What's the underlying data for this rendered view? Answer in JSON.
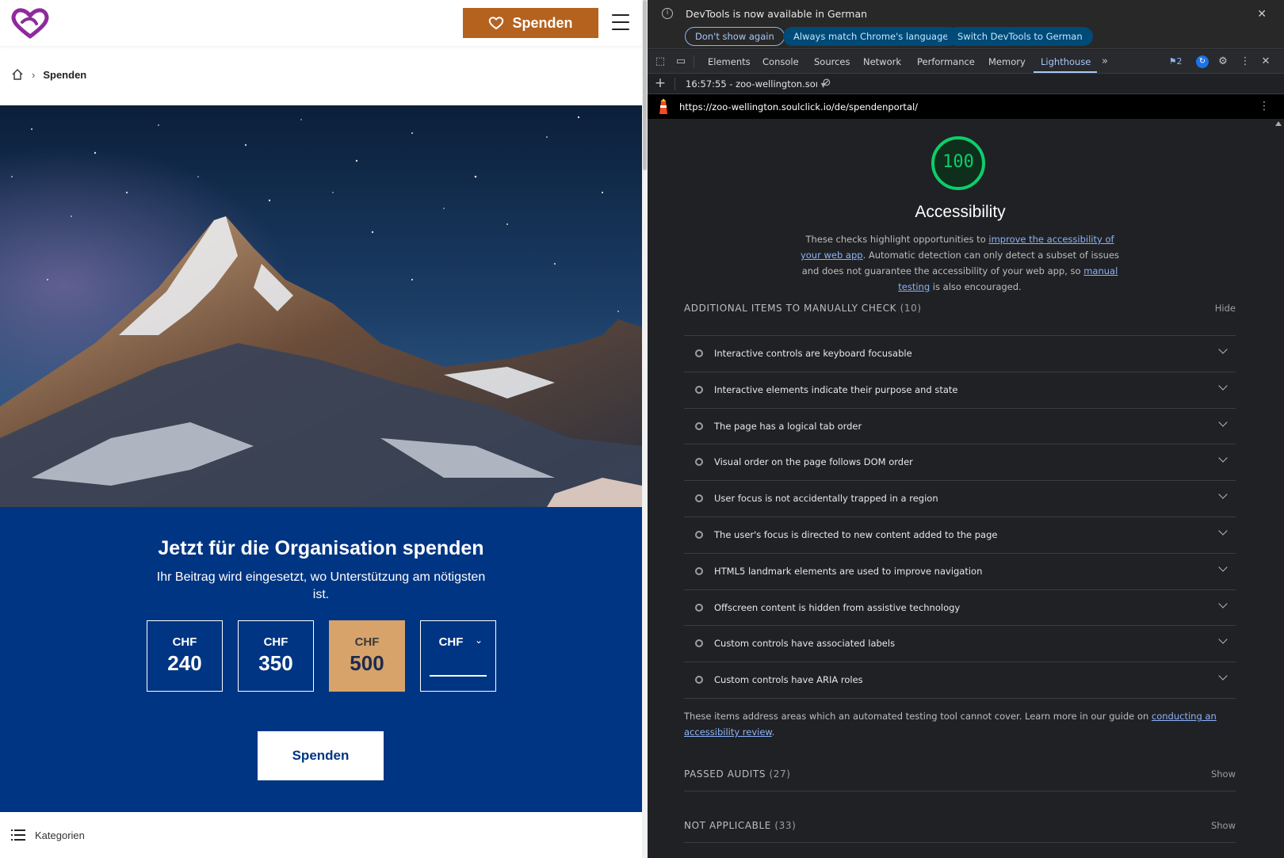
{
  "site": {
    "header": {
      "donate_label": "Spenden"
    },
    "breadcrumb": {
      "current": "Spenden"
    },
    "donation": {
      "title": "Jetzt für die Organisation spenden",
      "subtitle": "Ihr Beitrag wird eingesetzt, wo Unterstützung am nötigsten ist.",
      "currency": "CHF",
      "amounts": [
        {
          "value": "240",
          "selected": false
        },
        {
          "value": "350",
          "selected": false
        },
        {
          "value": "500",
          "selected": true
        }
      ],
      "custom_amount": "",
      "submit_label": "Spenden"
    },
    "footer": {
      "categories_label": "Kategorien"
    },
    "colors": {
      "brand_orange": "#b5621f",
      "panel_blue": "#003583",
      "selected_amount": "#d7a36a",
      "logo_purple": "#8e2a9c"
    }
  },
  "devtools": {
    "infobar": {
      "message": "DevTools is now available in German",
      "buttons": [
        "Don't show again",
        "Always match Chrome's language",
        "Switch DevTools to German"
      ]
    },
    "tabs": [
      "Elements",
      "Console",
      "Sources",
      "Network",
      "Performance",
      "Memory",
      "Lighthouse"
    ],
    "active_tab": "Lighthouse",
    "issues_count": "2",
    "report_selector": "16:57:55 - zoo-wellington.soı",
    "url": "https://zoo-wellington.soulclick.io/de/spendenportal/",
    "report": {
      "score": "100",
      "category": "Accessibility",
      "description": {
        "p1": "These checks highlight opportunities to ",
        "link1": "improve the accessibility of your web app",
        "p2": ". Automatic detection can only detect a subset of issues and does not guarantee the accessibility of your web app, so ",
        "link2": "manual testing",
        "p3": " is also encouraged."
      },
      "manual_section": {
        "title": "ADDITIONAL ITEMS TO MANUALLY CHECK",
        "count": "(10)",
        "toggle": "Hide"
      },
      "manual_items": [
        "Interactive controls are keyboard focusable",
        "Interactive elements indicate their purpose and state",
        "The page has a logical tab order",
        "Visual order on the page follows DOM order",
        "User focus is not accidentally trapped in a region",
        "The user's focus is directed to new content added to the page",
        "HTML5 landmark elements are used to improve navigation",
        "Offscreen content is hidden from assistive technology",
        "Custom controls have associated labels",
        "Custom controls have ARIA roles"
      ],
      "manual_note": {
        "text": "These items address areas which an automated testing tool cannot cover. Learn more in our guide on ",
        "link": "conducting an accessibility review",
        "end": "."
      },
      "passed_section": {
        "title": "PASSED AUDITS",
        "count": "(27)",
        "toggle": "Show"
      },
      "na_section": {
        "title": "NOT APPLICABLE",
        "count": "(33)",
        "toggle": "Show"
      },
      "colors": {
        "score_green": "#0cce6b",
        "link_blue": "#8ab4f8"
      }
    }
  }
}
